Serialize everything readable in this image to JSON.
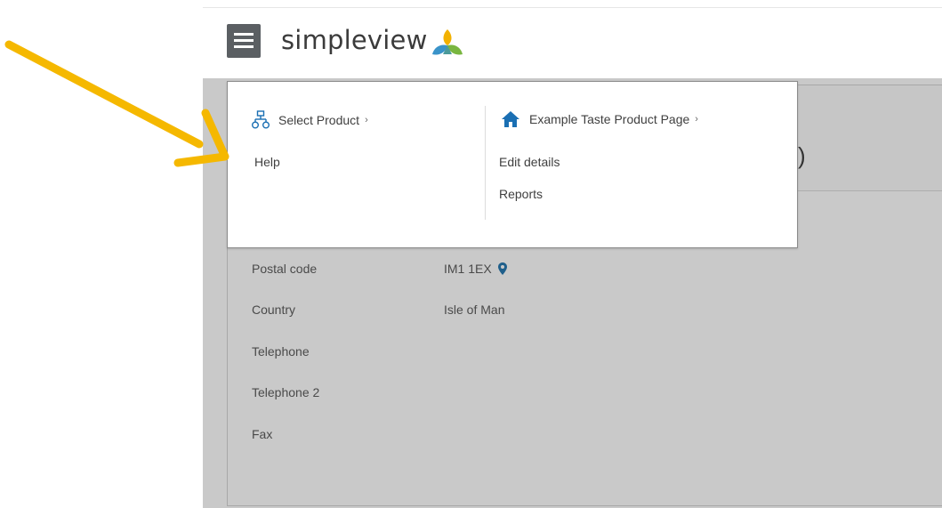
{
  "app": {
    "logo_text": "simpleview"
  },
  "header": {
    "menu_icon": "hamburger-menu-icon",
    "logo_icon": "simpleview-leaf-logo"
  },
  "dropdown": {
    "left_column": {
      "heading": "Select Product",
      "heading_icon": "product-hierarchy-icon",
      "chevron": "›",
      "items": [
        "Help"
      ]
    },
    "right_column": {
      "heading": "Example Taste Product Page",
      "heading_icon": "home-icon",
      "chevron": "›",
      "items": [
        "Edit details",
        "Reports"
      ]
    }
  },
  "page": {
    "title_fragment": ")",
    "fields": [
      {
        "label": "Postal code",
        "value": "IM1 1EX",
        "icon": "map-pin-icon"
      },
      {
        "label": "Country",
        "value": "Isle of Man"
      },
      {
        "label": "Telephone",
        "value": ""
      },
      {
        "label": "Telephone 2",
        "value": ""
      },
      {
        "label": "Fax",
        "value": ""
      }
    ]
  },
  "colors": {
    "accent_arrow": "#F5B800",
    "menu_button": "#5b5f63",
    "page_background": "#c9c9c9",
    "link_icon_blue": "#1a6fb3",
    "pin_blue": "#1f5f8b"
  }
}
